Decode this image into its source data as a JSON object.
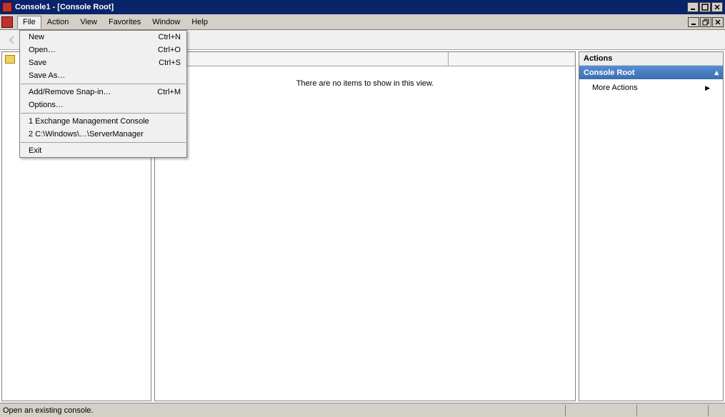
{
  "title": "Console1 - [Console Root]",
  "menubar": [
    "File",
    "Action",
    "View",
    "Favorites",
    "Window",
    "Help"
  ],
  "file_menu": {
    "new": {
      "label": "New",
      "shortcut": "Ctrl+N"
    },
    "open": {
      "label": "Open…",
      "shortcut": "Ctrl+O"
    },
    "save": {
      "label": "Save",
      "shortcut": "Ctrl+S"
    },
    "save_as": {
      "label": "Save As…",
      "shortcut": ""
    },
    "snapin": {
      "label": "Add/Remove Snap-in…",
      "shortcut": "Ctrl+M"
    },
    "options": {
      "label": "Options…",
      "shortcut": ""
    },
    "recent1": {
      "label": "1 Exchange Management Console",
      "shortcut": ""
    },
    "recent2": {
      "label": "2 C:\\Windows\\…\\ServerManager",
      "shortcut": ""
    },
    "exit": {
      "label": "Exit",
      "shortcut": ""
    }
  },
  "content": {
    "empty_message": "There are no items to show in this view."
  },
  "actions": {
    "title": "Actions",
    "section": "Console Root",
    "more": "More Actions"
  },
  "status": "Open an existing console."
}
